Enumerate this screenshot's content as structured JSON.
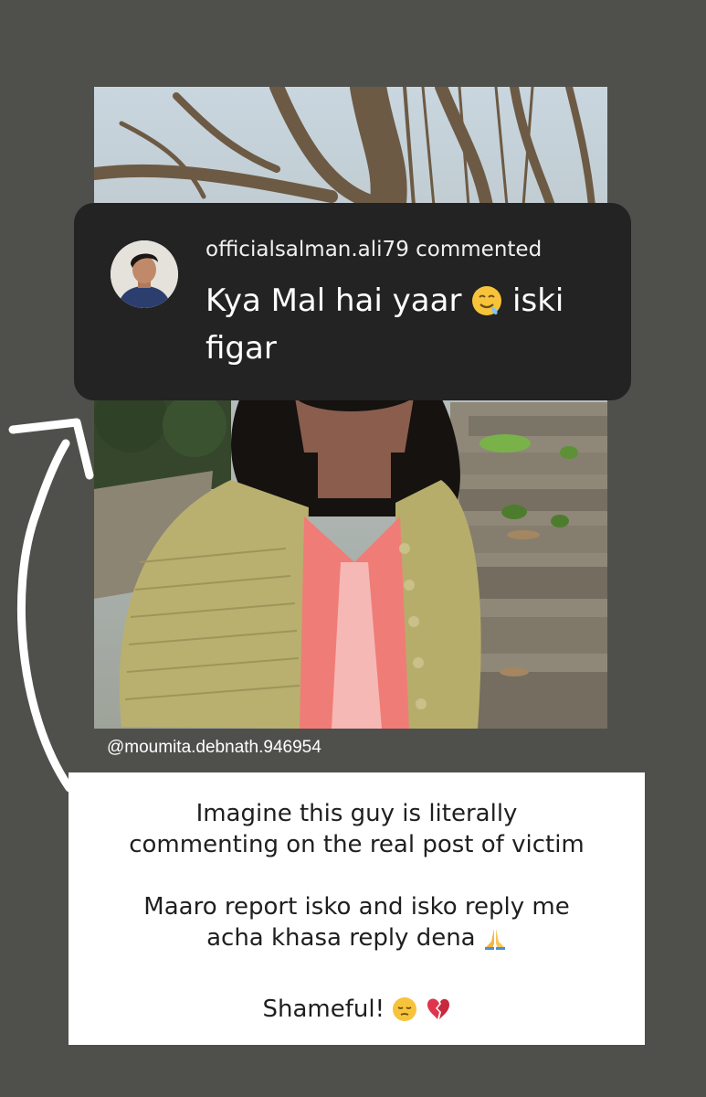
{
  "comment": {
    "username": "officialsalman.ali79",
    "action": "commented",
    "text_part1": "Kya Mal hai yaar",
    "emoji_name": "drooling-face-emoji",
    "text_part2": "iski figar"
  },
  "post": {
    "handle": "@moumita.debnath.946954"
  },
  "caption": {
    "paragraph1_line1": "Imagine this guy is literally",
    "paragraph1_line2": "commenting on the real post of victim",
    "paragraph2_line1": "Maaro report isko and isko reply me",
    "paragraph2_line2": "acha khasa reply dena",
    "paragraph2_emoji": "folded-hands-emoji",
    "paragraph3_text": "Shameful!",
    "paragraph3_emojis": [
      "pensive-face-emoji",
      "broken-heart-emoji"
    ]
  },
  "colors": {
    "background": "#4f504c",
    "card": "#232323",
    "caption_box": "#ffffff"
  }
}
